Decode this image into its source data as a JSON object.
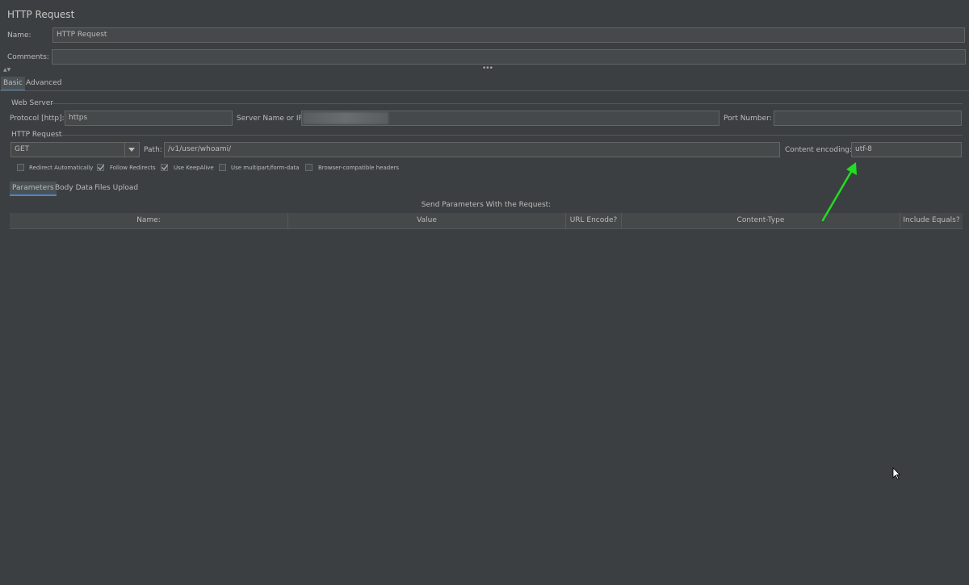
{
  "header": {
    "title": "HTTP Request"
  },
  "name": {
    "label": "Name:",
    "value": "HTTP Request"
  },
  "comments": {
    "label": "Comments:",
    "value": ""
  },
  "tabs": [
    {
      "label": "Basic"
    },
    {
      "label": "Advanced"
    }
  ],
  "web_server": {
    "section_title": "Web Server",
    "protocol_label": "Protocol [http]:",
    "protocol_value": "https",
    "server_label": "Server Name or IP:",
    "server_value": "",
    "port_label": "Port Number:",
    "port_value": ""
  },
  "http_request": {
    "section_title": "HTTP Request",
    "method": "GET",
    "path_label": "Path:",
    "path_value": "/v1/user/whoami/",
    "encoding_label": "Content encoding:",
    "encoding_value": "utf-8"
  },
  "options": [
    {
      "label": "Redirect Automatically",
      "checked": false
    },
    {
      "label": "Follow Redirects",
      "checked": true
    },
    {
      "label": "Use KeepAlive",
      "checked": true
    },
    {
      "label": "Use multipart/form-data",
      "checked": false
    },
    {
      "label": "Browser-compatible headers",
      "checked": false
    }
  ],
  "sub_tabs": [
    {
      "label": "Parameters"
    },
    {
      "label": "Body Data"
    },
    {
      "label": "Files Upload"
    }
  ],
  "params_table": {
    "caption": "Send Parameters With the Request:",
    "columns": [
      "Name:",
      "Value",
      "URL Encode?",
      "Content-Type",
      "Include Equals?"
    ]
  },
  "colors": {
    "background": "#3c3f41",
    "field": "#45494a",
    "accent": "#4a88c7",
    "arrow": "#22dd22"
  }
}
